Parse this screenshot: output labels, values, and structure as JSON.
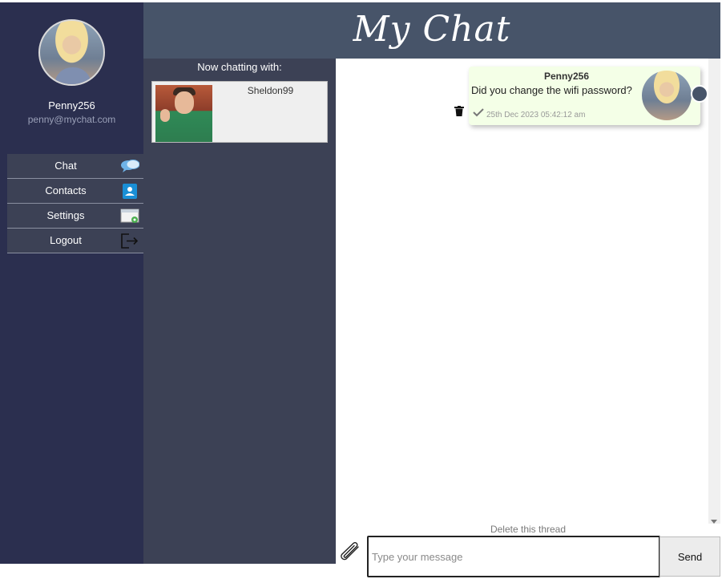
{
  "app": {
    "title": "My Chat"
  },
  "user": {
    "name": "Penny256",
    "email": "penny@mychat.com"
  },
  "menu": [
    {
      "label": "Chat",
      "icon": "chat-bubble-icon"
    },
    {
      "label": "Contacts",
      "icon": "contact-card-icon"
    },
    {
      "label": "Settings",
      "icon": "settings-window-icon"
    },
    {
      "label": "Logout",
      "icon": "logout-icon"
    }
  ],
  "contacts": {
    "heading": "Now chatting with:",
    "active": {
      "name": "Sheldon99"
    }
  },
  "messages": [
    {
      "sender": "Penny256",
      "text": "Did you change the wifi password?",
      "timestamp": "25th Dec 2023 05:42:12 am",
      "status": "sent"
    }
  ],
  "thread": {
    "delete_label": "Delete this thread"
  },
  "composer": {
    "placeholder": "Type your message",
    "value": "",
    "send_label": "Send"
  },
  "colors": {
    "sidebar": "#2b2f4f",
    "header": "#475469",
    "panel": "#3c4155",
    "bubble": "#f4ffe7"
  }
}
